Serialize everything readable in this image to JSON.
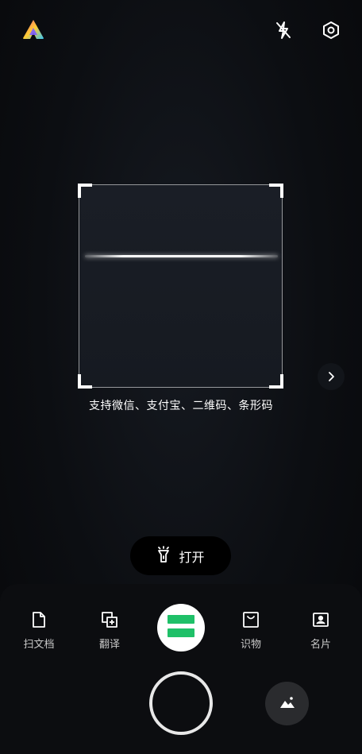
{
  "top_bar": {
    "logo_icon": "app-logo-icon",
    "flash_icon": "flash-off-icon",
    "settings_icon": "settings-hexagon-icon"
  },
  "scanner": {
    "hint": "支持微信、支付宝、二维码、条形码",
    "next_icon": "chevron-right-icon"
  },
  "torch": {
    "label": "打开",
    "icon": "flashlight-icon"
  },
  "modes": [
    {
      "label": "扫文档",
      "icon": "document-icon"
    },
    {
      "label": "翻译",
      "icon": "translate-icon"
    },
    {
      "label": "",
      "icon": "scan-qr-icon",
      "active": true
    },
    {
      "label": "识物",
      "icon": "object-recognition-icon"
    },
    {
      "label": "名片",
      "icon": "business-card-icon"
    }
  ],
  "colors": {
    "accent": "#1fc068",
    "background": "#0c0e12"
  },
  "bottom": {
    "shutter": "shutter-button",
    "gallery_icon": "gallery-icon"
  }
}
